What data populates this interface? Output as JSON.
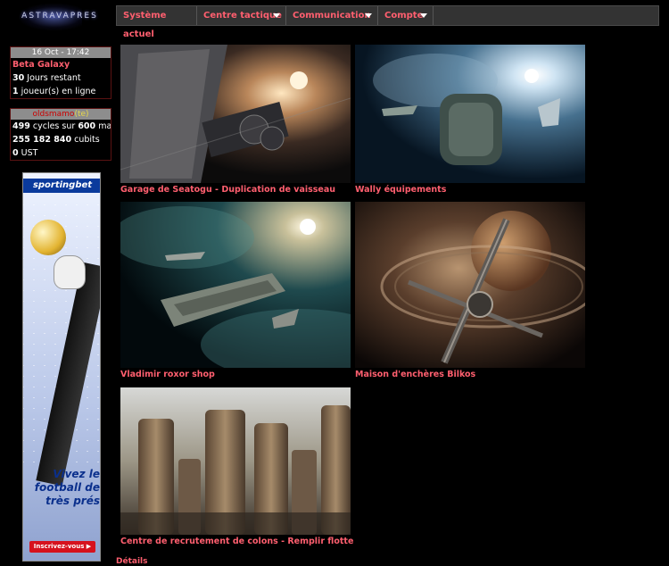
{
  "logo": {
    "text": "ASTRAVAPRES"
  },
  "menu": [
    {
      "label": "Système actuel",
      "has_dropdown": false
    },
    {
      "label": "Centre tactique",
      "has_dropdown": true
    },
    {
      "label": "Communication",
      "has_dropdown": true
    },
    {
      "label": "Compte",
      "has_dropdown": true
    }
  ],
  "status_box": {
    "date": "16 Oct - 17:42",
    "galaxy": "Beta Galaxy",
    "days_value": "30",
    "days_label": "Jours restant",
    "players_value": "1",
    "players_label": "joueur(s) en ligne"
  },
  "resources_box": {
    "head_name": "oldsmamo",
    "head_suffix": "(te)",
    "cycles_value": "499",
    "cycles_mid": "cycles sur",
    "cycles_max": "600",
    "cycles_end": "max",
    "cubits_value": "255 182 840",
    "cubits_label": "cubits",
    "ust_value": "0",
    "ust_label": "UST"
  },
  "ad": {
    "brand": "sportingbet",
    "slogan_1": "Vivez le",
    "slogan_2": "football de",
    "slogan_3": "très prés",
    "cta": "Inscrivez-vous ▶"
  },
  "tiles": [
    {
      "title": "Garage de Seatogu",
      "action": "Duplication de vaisseau"
    },
    {
      "title": "Wally équipements",
      "action": ""
    },
    {
      "title": "Vladimir roxor shop",
      "action": ""
    },
    {
      "title": "Maison d'enchères Bilkos",
      "action": ""
    },
    {
      "title": "Centre de recrutement de colons",
      "action": "Remplir flotte"
    }
  ],
  "footer_link": "Détails",
  "colors": {
    "accent": "#ff5f6f",
    "menu_bg": "#333333",
    "box_border": "#5a1212"
  }
}
